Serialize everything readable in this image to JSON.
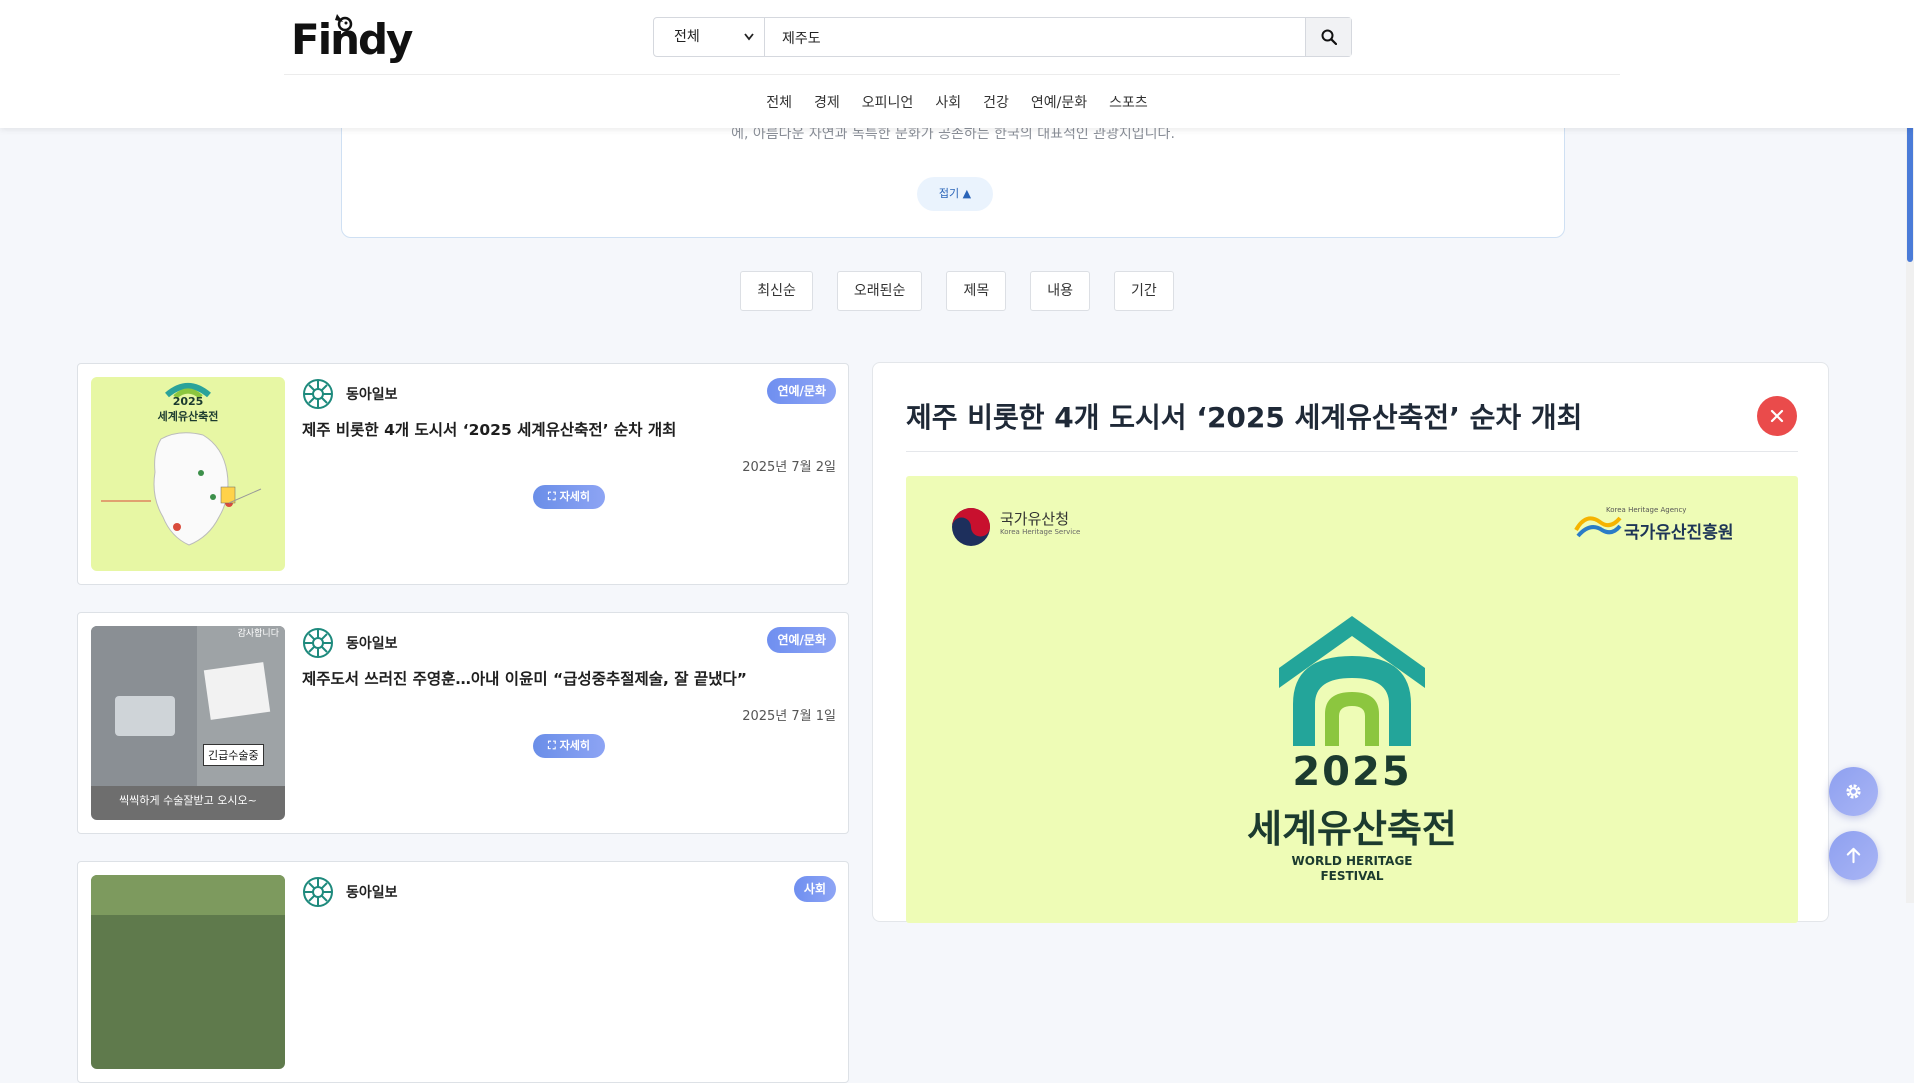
{
  "header": {
    "logo_text": "Findy",
    "search": {
      "category_selected": "전체",
      "query": "제주도"
    },
    "nav": [
      "전체",
      "경제",
      "오피니언",
      "사회",
      "건강",
      "연예/문화",
      "스포츠"
    ]
  },
  "description": {
    "text": "에, 아름다운 자연과 독특한 문화가 공존하는 한국의 대표적인 관광지입니다.",
    "fold_label": "접기 ▲"
  },
  "sort": [
    "최신순",
    "오래된순",
    "제목",
    "내용",
    "기간"
  ],
  "articles": [
    {
      "publisher": "동아일보",
      "category": "연예/문화",
      "title": "제주 비롯한 4개 도시서 ‘2025 세계유산축전’ 순차 개최",
      "date": "2025년 7월 2일",
      "detail_label": "⛶ 자세히",
      "thumb_title_1": "2025",
      "thumb_title_2": "세계유산축전"
    },
    {
      "publisher": "동아일보",
      "category": "연예/문화",
      "title": "제주도서 쓰러진 주영훈…아내 이윤미 “급성중추절제술, 잘 끝냈다”",
      "date": "2025년 7월 1일",
      "detail_label": "⛶ 자세히",
      "thumb_caption_top": "감사합니다",
      "thumb_caption_mid": "긴급수술중",
      "thumb_caption_bottom": "씩씩하게 수술잘받고 오시오~"
    },
    {
      "publisher": "동아일보",
      "category": "사회"
    }
  ],
  "detail": {
    "title": "제주 비롯한 4개 도시서 ‘2025 세계유산축전’ 순차 개최",
    "image": {
      "org_left_name": "국가유산청",
      "org_left_sub": "Korea Heritage Service",
      "org_right_name": "국가유산진흥원",
      "org_right_sub": "Korea Heritage Agency",
      "year": "2025",
      "festival_name": "세계유산축전",
      "english_1": "WORLD HERITAGE",
      "english_2": "FESTIVAL"
    }
  },
  "colors": {
    "accent": "#6f8ff0",
    "close": "#ea4b4b",
    "poster_bg": "#eefcb6"
  },
  "icons": [
    "search-icon",
    "chevron-down-icon",
    "close-icon",
    "gear-icon",
    "arrow-up-icon",
    "publisher-logo-icon",
    "expand-icon"
  ]
}
